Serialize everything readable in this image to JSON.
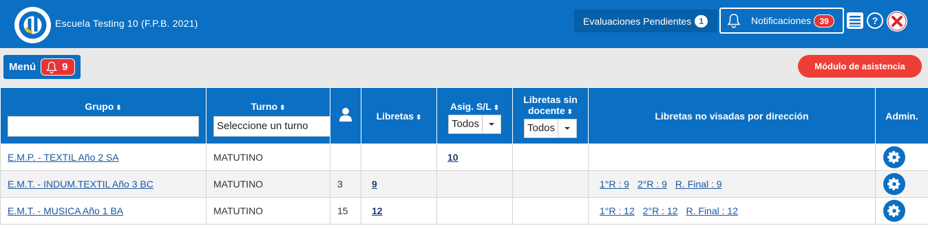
{
  "header": {
    "school_name": "Escuela Testing 10 (F.P.B. 2021)",
    "eval_label": "Evaluaciones Pendientes",
    "eval_count": "1",
    "notif_label": "Notificaciones",
    "notif_count": "39",
    "brand_color": "#0b6fc3"
  },
  "subbar": {
    "menu_label": "Menú",
    "menu_count": "9",
    "asistencia_label": "Módulo de asistencia"
  },
  "table": {
    "headers": {
      "grupo": "Grupo",
      "turno": "Turno",
      "libretas": "Libretas",
      "asig": "Asig. S/L",
      "sin_docente": "Libretas sin docente",
      "no_visadas": "Libretas no visadas por dirección",
      "admin": "Admin."
    },
    "turno_placeholder": "Seleccione un turno",
    "asig_value": "Todos",
    "sin_docente_value": "Todos",
    "rows": [
      {
        "grupo": "E.M.P. - TEXTIL Año 2 SA",
        "turno": "MATUTINO",
        "alumnos": "",
        "libretas": "",
        "asig": "10",
        "sin_docente": "",
        "nv": [
          "",
          "",
          ""
        ]
      },
      {
        "grupo": "E.M.T. - INDUM.TEXTIL Año 3 BC",
        "turno": "MATUTINO",
        "alumnos": "3",
        "libretas": "9",
        "asig": "",
        "sin_docente": "",
        "nv": [
          "1°R : 9",
          "2°R : 9",
          "R. Final : 9"
        ]
      },
      {
        "grupo": "E.M.T. - MUSICA Año 1 BA",
        "turno": "MATUTINO",
        "alumnos": "15",
        "libretas": "12",
        "asig": "",
        "sin_docente": "",
        "nv": [
          "1°R : 12",
          "2°R : 12",
          "R. Final : 12"
        ]
      }
    ]
  }
}
